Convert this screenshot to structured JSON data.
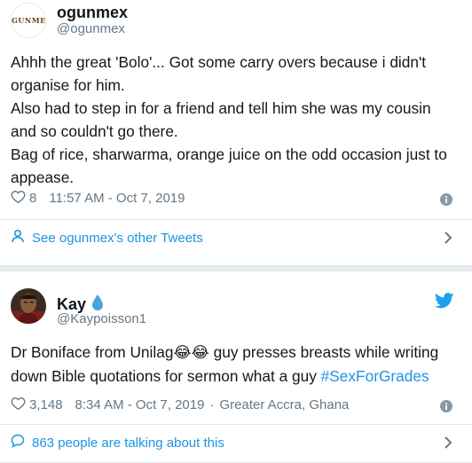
{
  "tweet1": {
    "avatar_logo_text": "OGUNMEX",
    "display_name": "ogunmex",
    "handle": "@ogunmex",
    "text_lines": [
      "Ahhh the great 'Bolo'... Got some carry overs because i didn't",
      "organise for him.",
      "Also had to step in for a friend and tell him she was my cousin",
      "and so couldn't go there.",
      "Bag of rice, sharwarma, orange juice on the odd occasion just to",
      "appease."
    ],
    "likes": "8",
    "timestamp": "11:57 AM - Oct 7, 2019",
    "footer_link": "See ogunmex's other Tweets"
  },
  "tweet2": {
    "display_name": "Kay",
    "handle": "@Kaypoisson1",
    "text_line1_before": "Dr Boniface from Unilag",
    "emoji": "😂😂",
    "text_line1_after": " guy presses breasts while writing",
    "text_line2": "down Bible quotations for sermon what a guy ",
    "hashtag": "#SexForGrades",
    "likes": "3,148",
    "timestamp": "8:34 AM - Oct 7, 2019",
    "location": "Greater Accra, Ghana",
    "footer_link": "863 people are talking about this"
  },
  "colors": {
    "link_blue": "#1b95e0",
    "twitter_blue": "#1da1f2",
    "secondary_gray": "#657786",
    "text": "#14171a"
  },
  "icons": [
    "heart-icon",
    "info-icon",
    "person-icon",
    "chevron-right-icon",
    "droplet-icon",
    "twitter-bird-icon",
    "comment-icon"
  ]
}
